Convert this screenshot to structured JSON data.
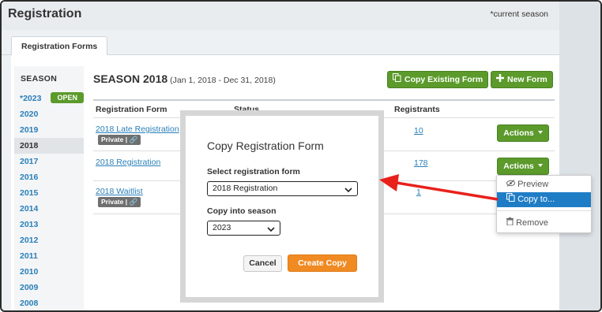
{
  "header": {
    "title": "Registration",
    "current_season_note": "*current season"
  },
  "tabs": [
    {
      "label": "Registration Forms"
    }
  ],
  "sidebar": {
    "title": "SEASON",
    "items": [
      {
        "label": "*2023",
        "badge": "OPEN"
      },
      {
        "label": "2020"
      },
      {
        "label": "2019"
      },
      {
        "label": "2018",
        "active": true
      },
      {
        "label": "2017"
      },
      {
        "label": "2016"
      },
      {
        "label": "2015"
      },
      {
        "label": "2014"
      },
      {
        "label": "2013"
      },
      {
        "label": "2012"
      },
      {
        "label": "2011"
      },
      {
        "label": "2010"
      },
      {
        "label": "2009"
      },
      {
        "label": "2008"
      }
    ]
  },
  "main": {
    "season_title": "SEASON 2018",
    "season_range": "(Jan 1, 2018 - Dec 31, 2018)",
    "copy_existing_label": "Copy Existing Form",
    "new_form_label": "New Form",
    "columns": [
      "Registration Form",
      "Status",
      "Registrants"
    ],
    "rows": [
      {
        "form": "2018 Late Registration",
        "private": "Private |",
        "registrants": "10",
        "actions": "Actions"
      },
      {
        "form": "2018 Registration",
        "registrants": "178",
        "actions": "Actions"
      },
      {
        "form": "2018 Waitlist",
        "private": "Private |",
        "registrants": "1"
      }
    ]
  },
  "actions_menu": {
    "items": [
      {
        "label": "Preview",
        "icon": "eye-slash-icon"
      },
      {
        "label": "Copy to...",
        "icon": "copy-icon",
        "highlighted": true
      },
      {
        "label": "Remove",
        "icon": "trash-icon"
      }
    ]
  },
  "modal": {
    "title": "Copy Registration Form",
    "select_form_label": "Select registration form",
    "select_form_value": "2018 Registration",
    "season_label": "Copy into season",
    "season_value": "2023",
    "cancel_label": "Cancel",
    "create_label": "Create Copy"
  },
  "colors": {
    "green": "#5b9a2b",
    "link": "#2a7fb8",
    "orange": "#f08a23",
    "highlight": "#1f7dc6",
    "arrow": "#e8211c"
  }
}
